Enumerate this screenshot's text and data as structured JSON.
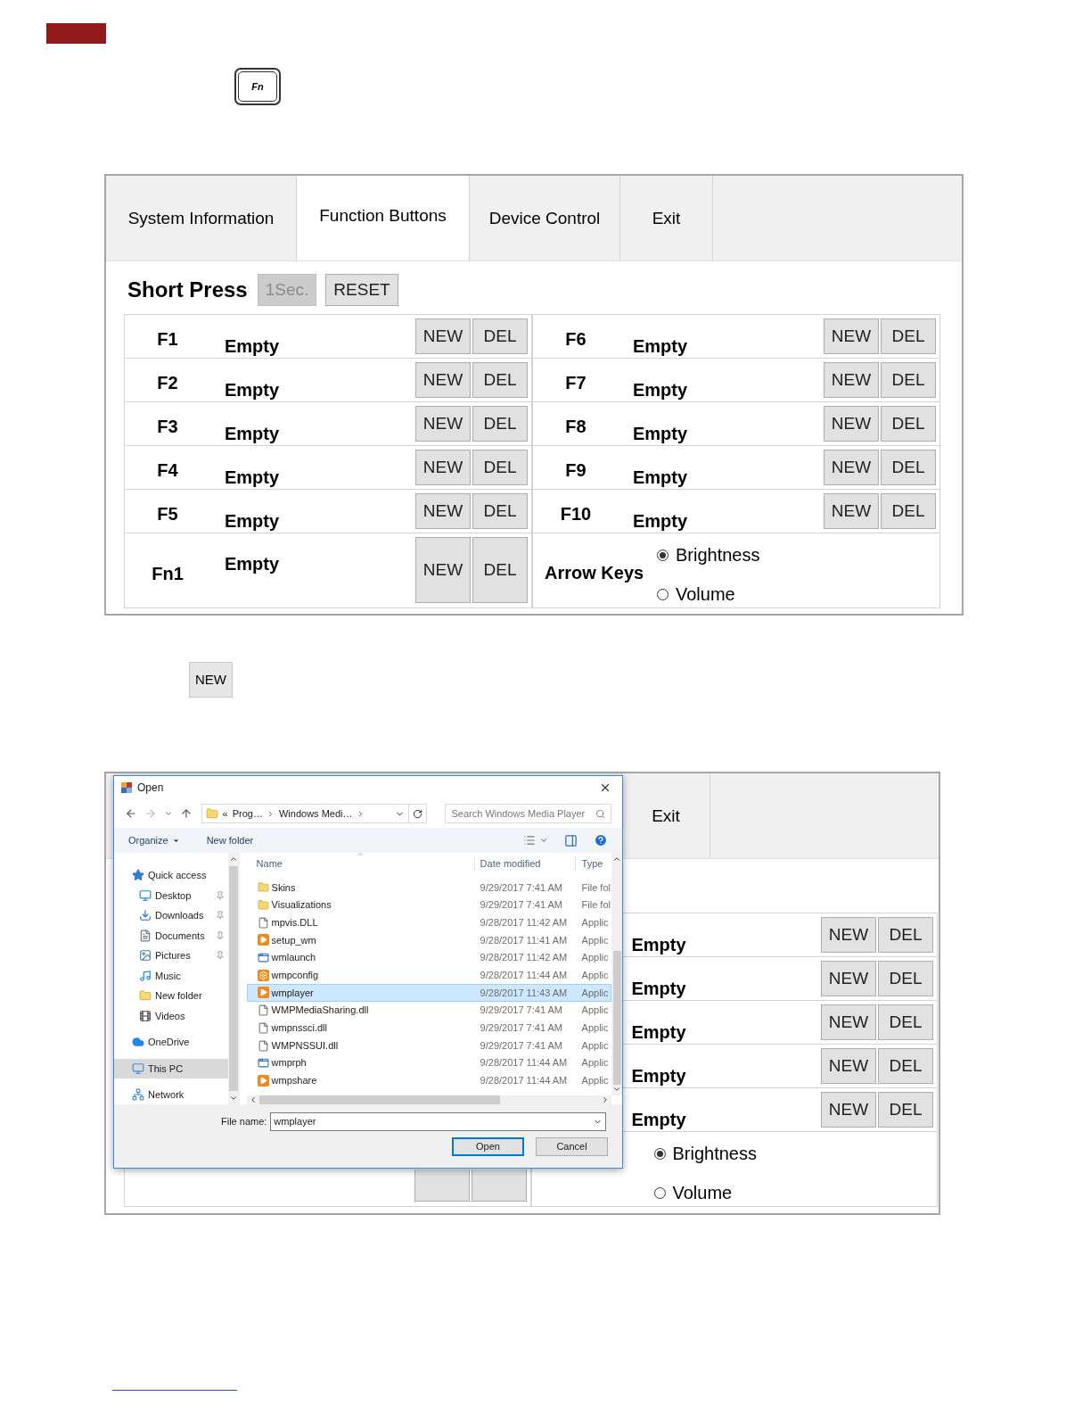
{
  "fn_key": {
    "label": "Fn"
  },
  "panel_1": {
    "tabs": [
      {
        "label": "System Information",
        "selected": false
      },
      {
        "label": "Function Buttons",
        "selected": true
      },
      {
        "label": "Device Control",
        "selected": false
      },
      {
        "label": "Exit",
        "selected": false
      }
    ],
    "mode": {
      "title": "Short Press",
      "buttons": [
        {
          "label": "1Sec.",
          "disabled": true
        },
        {
          "label": "RESET",
          "disabled": false
        }
      ]
    },
    "keys_left": [
      {
        "key": "F1",
        "value": "Empty",
        "buttons": [
          "NEW",
          "DEL"
        ]
      },
      {
        "key": "F2",
        "value": "Empty",
        "buttons": [
          "NEW",
          "DEL"
        ]
      },
      {
        "key": "F3",
        "value": "Empty",
        "buttons": [
          "NEW",
          "DEL"
        ]
      },
      {
        "key": "F4",
        "value": "Empty",
        "buttons": [
          "NEW",
          "DEL"
        ]
      },
      {
        "key": "F5",
        "value": "Empty",
        "buttons": [
          "NEW",
          "DEL"
        ]
      }
    ],
    "keys_right": [
      {
        "key": "F6",
        "value": "Empty",
        "buttons": [
          "NEW",
          "DEL"
        ]
      },
      {
        "key": "F7",
        "value": "Empty",
        "buttons": [
          "NEW",
          "DEL"
        ]
      },
      {
        "key": "F8",
        "value": "Empty",
        "buttons": [
          "NEW",
          "DEL"
        ]
      },
      {
        "key": "F9",
        "value": "Empty",
        "buttons": [
          "NEW",
          "DEL"
        ]
      },
      {
        "key": "F10",
        "value": "Empty",
        "buttons": [
          "NEW",
          "DEL"
        ]
      }
    ],
    "fn1": {
      "key": "Fn1",
      "value": "Empty",
      "buttons": [
        "NEW",
        "DEL"
      ]
    },
    "arrow_keys": {
      "label": "Arrow Keys",
      "options": [
        {
          "label": "Brightness",
          "selected": true
        },
        {
          "label": "Volume",
          "selected": false
        }
      ]
    }
  },
  "new_button": {
    "label": "NEW"
  },
  "panel_2": {
    "tabs": [
      {
        "label": "Exit",
        "selected": false
      }
    ],
    "rows": [
      {
        "value": "Empty",
        "buttons": [
          "NEW",
          "DEL"
        ]
      },
      {
        "value": "Empty",
        "buttons": [
          "NEW",
          "DEL"
        ]
      },
      {
        "value": "Empty",
        "buttons": [
          "NEW",
          "DEL"
        ]
      },
      {
        "value": "Empty",
        "buttons": [
          "NEW",
          "DEL"
        ]
      },
      {
        "value": "Empty",
        "buttons": [
          "NEW",
          "DEL"
        ]
      }
    ],
    "arrow_keys": {
      "options": [
        {
          "label": "Brightness",
          "selected": true
        },
        {
          "label": "Volume",
          "selected": false
        }
      ]
    },
    "dialog": {
      "title": "Open",
      "path": [
        "«",
        "Prog…",
        "Windows Medi…"
      ],
      "search": {
        "placeholder": "Search Windows Media Player"
      },
      "toolbar": [
        {
          "label": "Organize",
          "kind": "menu"
        },
        {
          "label": "New folder",
          "kind": "button"
        }
      ],
      "nav": [
        {
          "label": "Quick access",
          "kind": "quick-access",
          "selected": false,
          "children": [
            {
              "label": "Desktop",
              "kind": "desktop",
              "pinned": true,
              "selected": false
            },
            {
              "label": "Downloads",
              "kind": "downloads",
              "pinned": true,
              "selected": false
            },
            {
              "label": "Documents",
              "kind": "documents",
              "pinned": true,
              "selected": false
            },
            {
              "label": "Pictures",
              "kind": "pictures",
              "pinned": true,
              "selected": false
            },
            {
              "label": "Music",
              "kind": "music",
              "pinned": false,
              "selected": false
            },
            {
              "label": "New folder",
              "kind": "folder",
              "pinned": false,
              "selected": false
            },
            {
              "label": "Videos",
              "kind": "videos",
              "pinned": false,
              "selected": false
            }
          ]
        },
        {
          "label": "OneDrive",
          "kind": "cloud",
          "selected": false
        },
        {
          "label": "This PC",
          "kind": "pc",
          "selected": true
        },
        {
          "label": "Network",
          "kind": "network",
          "selected": false
        }
      ],
      "columns": [
        "Name",
        "Date modified",
        "Type"
      ],
      "files": [
        {
          "name": "Skins",
          "date": "9/29/2017 7:41 AM",
          "type": "File fol",
          "kind": "folder",
          "selected": false
        },
        {
          "name": "Visualizations",
          "date": "9/29/2017 7:41 AM",
          "type": "File fol",
          "kind": "folder",
          "selected": false
        },
        {
          "name": "mpvis.DLL",
          "date": "9/28/2017 11:42 AM",
          "type": "Applic",
          "kind": "dll",
          "selected": false
        },
        {
          "name": "setup_wm",
          "date": "9/28/2017 11:41 AM",
          "type": "Applic",
          "kind": "media",
          "selected": false
        },
        {
          "name": "wmlaunch",
          "date": "9/28/2017 11:42 AM",
          "type": "Applic",
          "kind": "window",
          "selected": false
        },
        {
          "name": "wmpconfig",
          "date": "9/28/2017 11:44 AM",
          "type": "Applic",
          "kind": "config",
          "selected": false
        },
        {
          "name": "wmplayer",
          "date": "9/28/2017 11:43 AM",
          "type": "Applic",
          "kind": "media",
          "selected": true
        },
        {
          "name": "WMPMediaSharing.dll",
          "date": "9/29/2017 7:41 AM",
          "type": "Applic",
          "kind": "dll",
          "selected": false
        },
        {
          "name": "wmpnssci.dll",
          "date": "9/29/2017 7:41 AM",
          "type": "Applic",
          "kind": "dll",
          "selected": false
        },
        {
          "name": "WMPNSSUI.dll",
          "date": "9/29/2017 7:41 AM",
          "type": "Applic",
          "kind": "dll",
          "selected": false
        },
        {
          "name": "wmprph",
          "date": "9/28/2017 11:44 AM",
          "type": "Applic",
          "kind": "window",
          "selected": false
        },
        {
          "name": "wmpshare",
          "date": "9/28/2017 11:44 AM",
          "type": "Applic",
          "kind": "media",
          "selected": false
        }
      ],
      "file_name": {
        "label": "File name:",
        "value": "wmplayer"
      },
      "buttons": [
        {
          "label": "Open",
          "default": true
        },
        {
          "label": "Cancel",
          "default": false
        }
      ]
    }
  }
}
